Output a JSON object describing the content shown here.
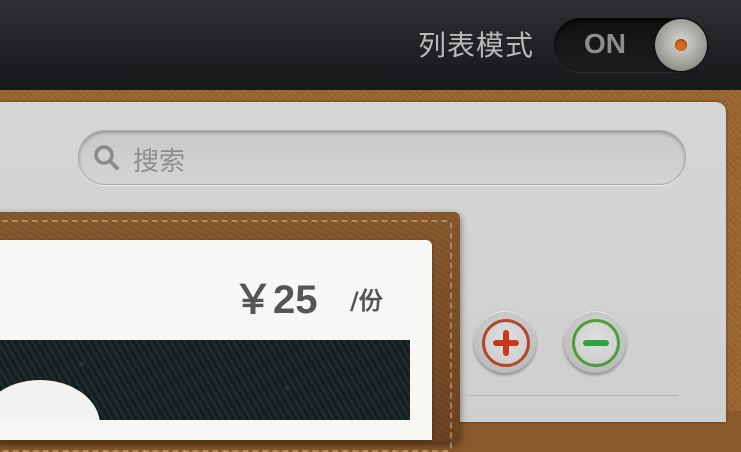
{
  "header": {
    "mode_label": "列表模式",
    "toggle_text": "ON",
    "toggle_on": true
  },
  "search": {
    "placeholder": "搜索"
  },
  "item": {
    "price": "￥25",
    "unit": "/份"
  },
  "icons": {
    "search": "search-icon",
    "add": "plus-icon",
    "remove": "minus-icon"
  },
  "colors": {
    "accent_orange": "#d66a1c",
    "add_red": "#c8391b",
    "remove_green": "#2fa33a"
  }
}
